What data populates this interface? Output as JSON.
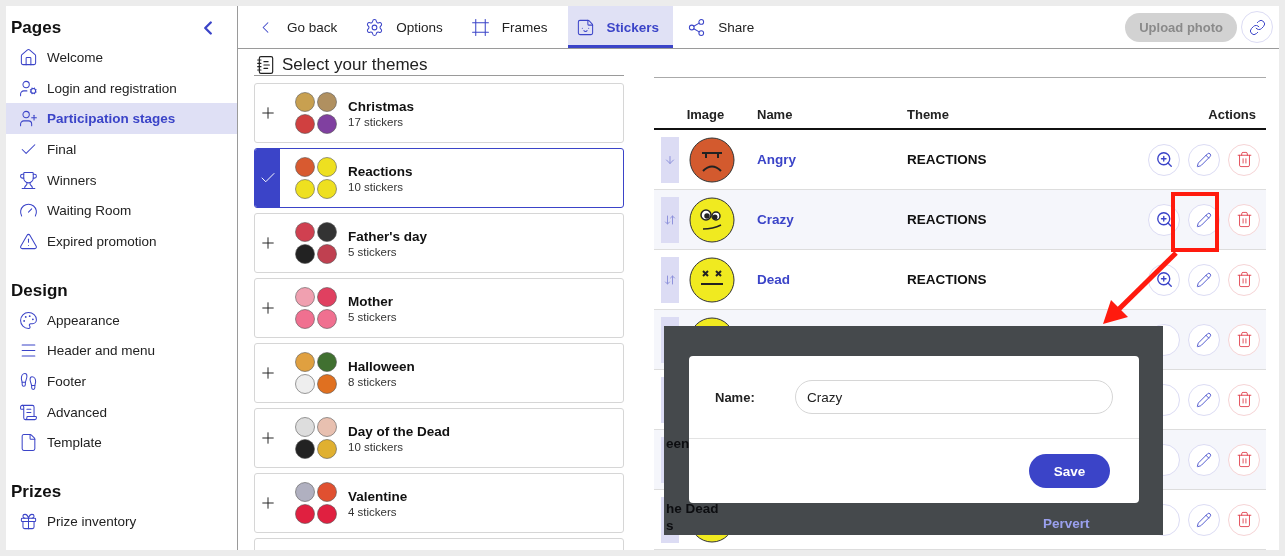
{
  "sidebar": {
    "sections": [
      {
        "title": "Pages",
        "items": [
          {
            "label": "Welcome",
            "selected": false
          },
          {
            "label": "Login and registration",
            "selected": false
          },
          {
            "label": "Participation stages",
            "selected": true
          },
          {
            "label": "Final",
            "selected": false
          },
          {
            "label": "Winners",
            "selected": false
          },
          {
            "label": "Waiting Room",
            "selected": false
          },
          {
            "label": "Expired promotion",
            "selected": false
          }
        ]
      },
      {
        "title": "Design",
        "items": [
          {
            "label": "Appearance",
            "selected": false
          },
          {
            "label": "Header and menu",
            "selected": false
          },
          {
            "label": "Footer",
            "selected": false
          },
          {
            "label": "Advanced",
            "selected": false
          },
          {
            "label": "Template",
            "selected": false
          }
        ]
      },
      {
        "title": "Prizes",
        "items": [
          {
            "label": "Prize inventory",
            "selected": false
          }
        ]
      }
    ]
  },
  "toolbar": {
    "tabs": [
      {
        "label": "Go back",
        "selected": false
      },
      {
        "label": "Options",
        "selected": false
      },
      {
        "label": "Frames",
        "selected": false
      },
      {
        "label": "Stickers",
        "selected": true
      },
      {
        "label": "Share",
        "selected": false
      }
    ],
    "upload_button": {
      "label": "Upload photo",
      "disabled": true
    }
  },
  "themes": {
    "title": "Select your themes",
    "items": [
      {
        "name": "Christmas",
        "count": "17 stickers",
        "selected": false
      },
      {
        "name": "Reactions",
        "count": "10 stickers",
        "selected": true
      },
      {
        "name": "Father's day",
        "count": "5 stickers",
        "selected": false
      },
      {
        "name": "Mother",
        "count": "5 stickers",
        "selected": false
      },
      {
        "name": "Halloween",
        "count": "8 stickers",
        "selected": false
      },
      {
        "name": "Day of the Dead",
        "count": "10 stickers",
        "selected": false
      },
      {
        "name": "Valentine",
        "count": "4 stickers",
        "selected": false
      }
    ]
  },
  "table": {
    "columns": [
      "Image",
      "Name",
      "Theme",
      "Actions"
    ],
    "rows": [
      {
        "name": "Angry",
        "theme": "REACTIONS"
      },
      {
        "name": "Crazy",
        "theme": "REACTIONS"
      },
      {
        "name": "Dead",
        "theme": "REACTIONS"
      }
    ]
  },
  "inset": {
    "texts": [
      "een",
      "he Dead",
      "s",
      "Pervert"
    ],
    "dialog": {
      "label": "Name:",
      "value": "Crazy",
      "button": "Save"
    }
  }
}
